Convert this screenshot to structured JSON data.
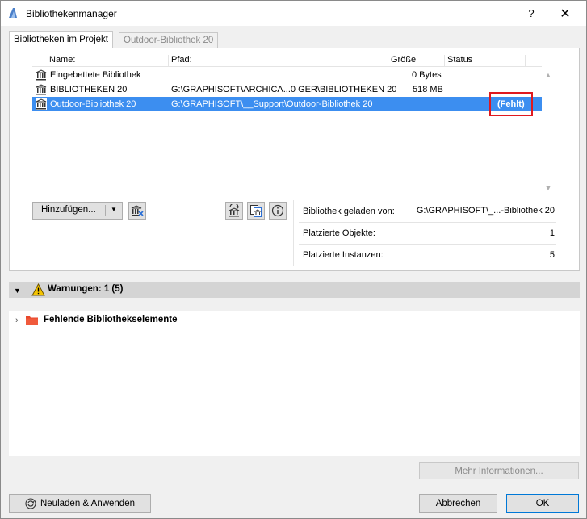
{
  "window": {
    "title": "Bibliothekenmanager",
    "help_label": "?",
    "close_label": "✕"
  },
  "tabs": [
    {
      "label": "Bibliotheken im Projekt",
      "active": true
    },
    {
      "label": "Outdoor-Bibliothek 20",
      "active": false
    }
  ],
  "library_list": {
    "columns": [
      "Name:",
      "Pfad:",
      "Größe",
      "Status"
    ],
    "rows": [
      {
        "name": "Eingebettete Bibliothek",
        "path": "",
        "size": "0 Bytes",
        "status": "",
        "selected": false
      },
      {
        "name": "BIBLIOTHEKEN 20",
        "path": "G:\\GRAPHISOFT\\ARCHICA...0 GER\\BIBLIOTHEKEN 20",
        "size": "518 MB",
        "status": "",
        "selected": false
      },
      {
        "name": "Outdoor-Bibliothek 20",
        "path": "G:\\GRAPHISOFT\\__Support\\Outdoor-Bibliothek 20",
        "size": "",
        "status": "(Fehlt)",
        "selected": true
      }
    ]
  },
  "toolbar": {
    "add_label": "Hinzufügen...",
    "dropdown_arrow": "▼"
  },
  "details": {
    "loaded_from_label": "Bibliothek geladen von:",
    "loaded_from_value": "G:\\GRAPHISOFT\\_...-Bibliothek 20",
    "placed_objects_label": "Platzierte Objekte:",
    "placed_objects_value": "1",
    "placed_instances_label": "Platzierte Instanzen:",
    "placed_instances_value": "5"
  },
  "warnings": {
    "header": "Warnungen: 1 (5)",
    "items": [
      {
        "label": "Fehlende Bibliothekselemente"
      }
    ]
  },
  "buttons": {
    "more_info": "Mehr Informationen...",
    "reload_apply": "Neuladen & Anwenden",
    "cancel": "Abbrechen",
    "ok": "OK"
  },
  "colors": {
    "selection": "#3c8ef0",
    "highlight_box": "#e0191f",
    "folder": "#e8482c",
    "warning": "#f5c400"
  }
}
